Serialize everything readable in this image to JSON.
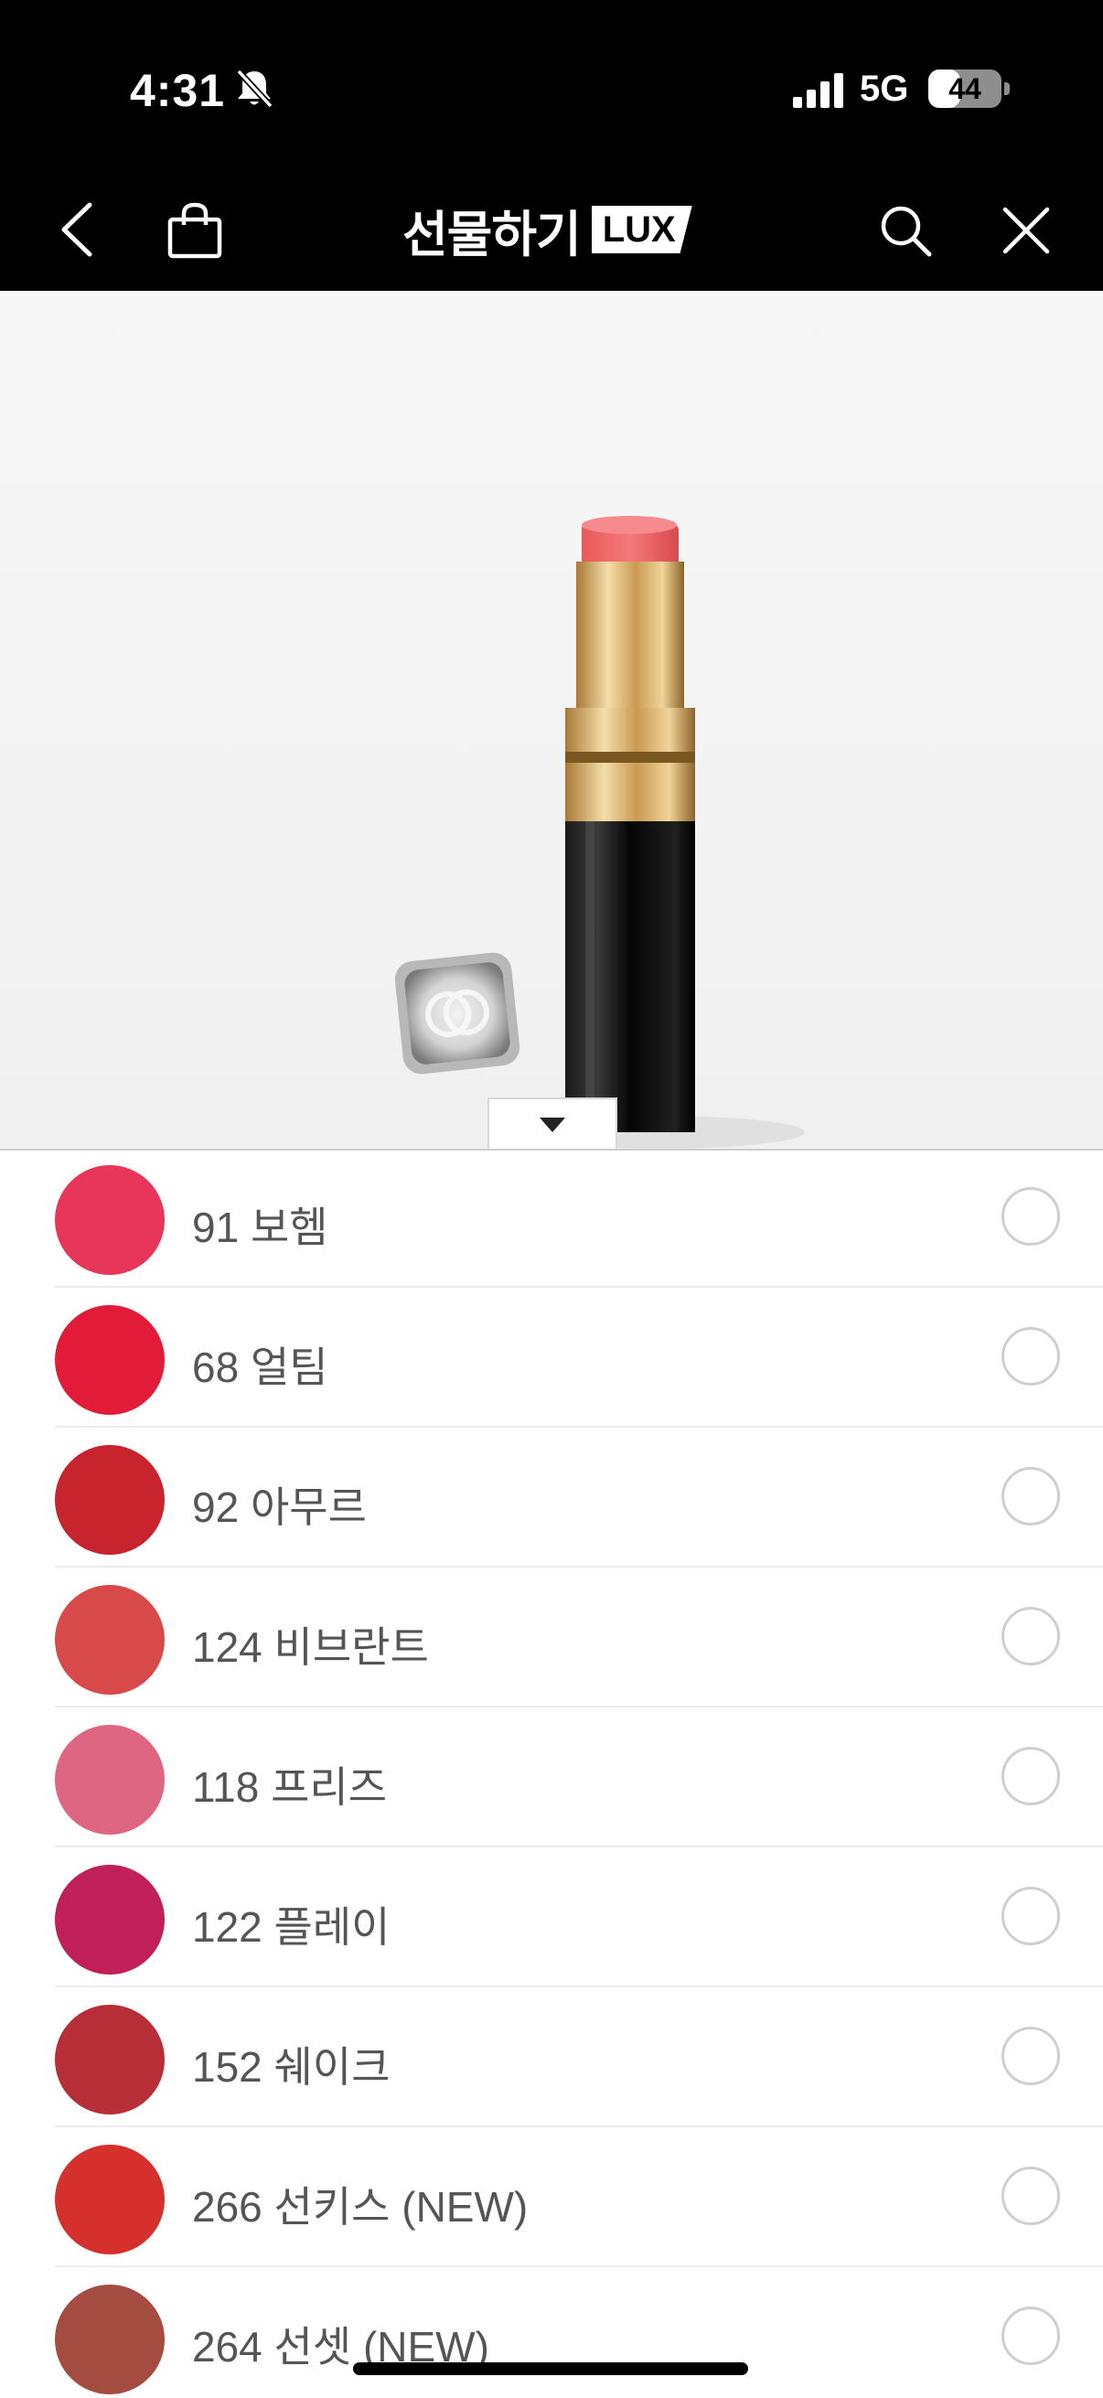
{
  "status_bar": {
    "time": "4:31",
    "network": "5G",
    "battery_level": "44",
    "battery_fraction": 0.44,
    "icons": [
      "bell-slash-icon",
      "signal-icon"
    ]
  },
  "nav": {
    "title": "선물하기",
    "badge": "LUX",
    "icons": [
      "back-icon",
      "shopping-bag-icon",
      "search-icon",
      "close-icon"
    ]
  },
  "product": {
    "image_subject": "lipstick-image",
    "collapse_icon": "caret-down-icon"
  },
  "shades": [
    {
      "label": "91 보헴",
      "color": "#e8365a"
    },
    {
      "label": "68 얼팀",
      "color": "#e21c38"
    },
    {
      "label": "92 아무르",
      "color": "#c8242e"
    },
    {
      "label": "124 비브란트",
      "color": "#d84a4a"
    },
    {
      "label": "118 프리즈",
      "color": "#df6682"
    },
    {
      "label": "122 플레이",
      "color": "#c02057"
    },
    {
      "label": "152 쉐이크",
      "color": "#b82e37"
    },
    {
      "label": "266 선키스 (NEW)",
      "color": "#d6302c"
    },
    {
      "label": "264 선셋 (NEW)",
      "color": "#a54c40"
    }
  ]
}
